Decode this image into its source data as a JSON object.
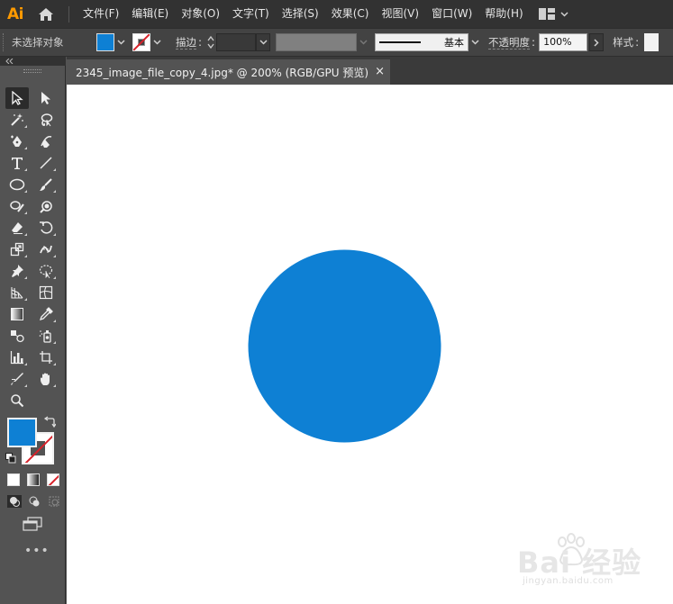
{
  "app": {
    "logo_text": "Ai",
    "accent_color": "#ff9a00"
  },
  "menubar": {
    "items": [
      "文件(F)",
      "编辑(E)",
      "对象(O)",
      "文字(T)",
      "选择(S)",
      "效果(C)",
      "视图(V)",
      "窗口(W)",
      "帮助(H)"
    ]
  },
  "controlbar": {
    "selection_status": "未选择对象",
    "fill_color": "#0e80d4",
    "stroke_label": "描边",
    "stroke_colon": ":",
    "stroke_profile_label": "基本",
    "opacity_label": "不透明度",
    "opacity_colon": ":",
    "opacity_value": "100%",
    "style_label": "样式",
    "style_colon": ":"
  },
  "document": {
    "tab_title": "2345_image_file_copy_4.jpg* @ 200% (RGB/GPU 预览)",
    "close_glyph": "×",
    "shape": {
      "type": "circle",
      "fill": "#0e80d4"
    }
  },
  "tools": {
    "fill_color": "#0e80d4",
    "stroke_color": "none",
    "more_glyph": "•••"
  },
  "watermark": {
    "text": "Bai 经验",
    "sub": "jingyan.baidu.com"
  }
}
